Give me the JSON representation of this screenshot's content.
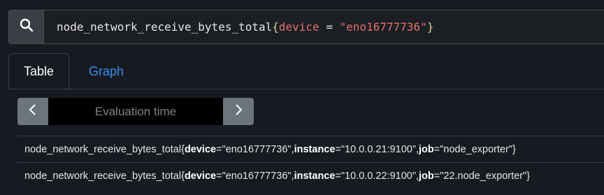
{
  "query": {
    "metric": "node_network_receive_bytes_total",
    "open_brace": "{",
    "label": "device",
    "operator": " = ",
    "value": "\"eno16777736\"",
    "close_brace": "}"
  },
  "icons": {
    "search": "search-icon",
    "prev": "chevron-left-icon",
    "next": "chevron-right-icon"
  },
  "tabs": [
    {
      "label": "Table",
      "active": true
    },
    {
      "label": "Graph",
      "active": false
    }
  ],
  "eval": {
    "placeholder": "Evaluation time"
  },
  "results": [
    {
      "metric": "node_network_receive_bytes_total",
      "labels": [
        {
          "key": "device",
          "value": "\"eno16777736\""
        },
        {
          "key": "instance",
          "value": "\"10.0.0.21:9100\""
        },
        {
          "key": "job",
          "value": "\"node_exporter\""
        }
      ]
    },
    {
      "metric": "node_network_receive_bytes_total",
      "labels": [
        {
          "key": "device",
          "value": "\"eno16777736\""
        },
        {
          "key": "instance",
          "value": "\"10.0.0.22:9100\""
        },
        {
          "key": "job",
          "value": "\"22.node_exporter\""
        }
      ]
    }
  ],
  "colors": {
    "background": "#171b21",
    "accent": "#3b8cf0",
    "label_token": "#e5706a",
    "brace_token": "#d6cf9b"
  }
}
